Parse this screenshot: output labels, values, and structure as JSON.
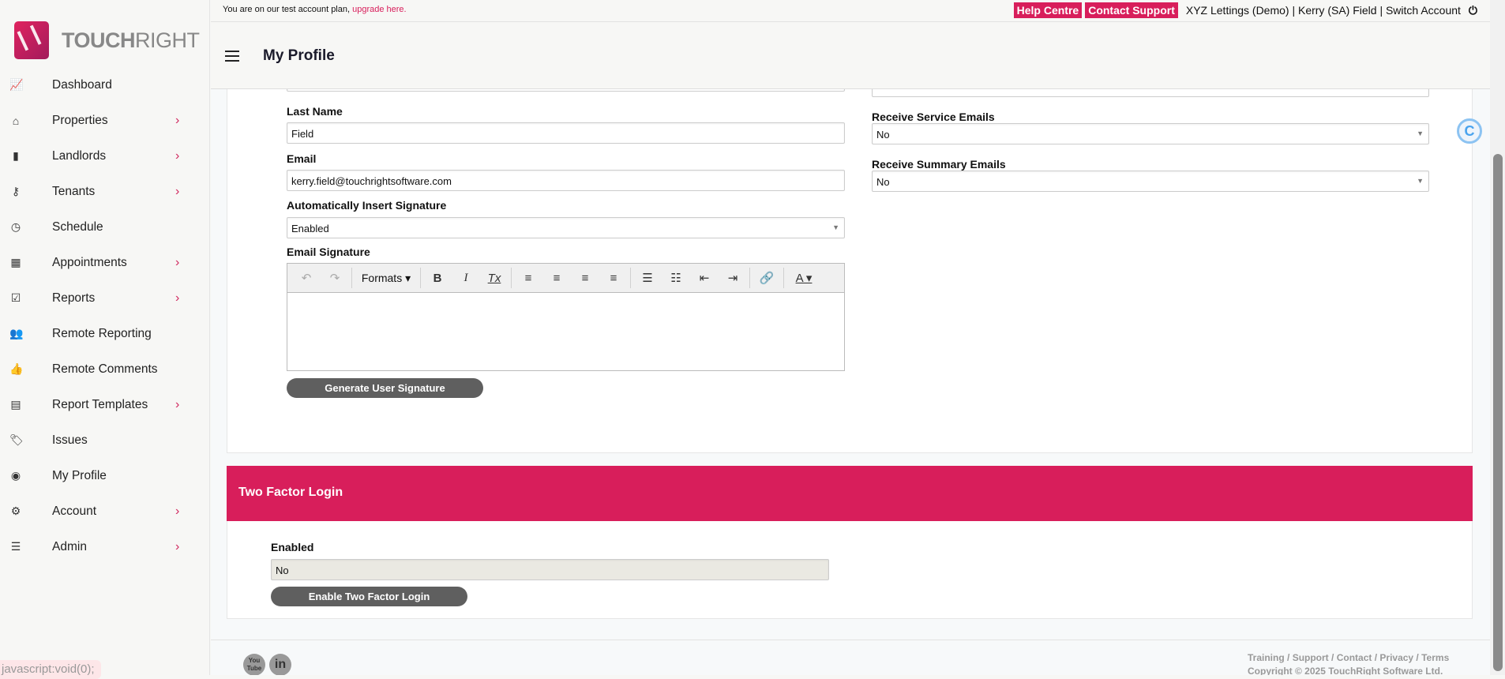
{
  "brand": {
    "logo_text_bold": "TOUCH",
    "logo_text_light": "RIGHT"
  },
  "topbar": {
    "plan_text": "You are on our test account plan, ",
    "upgrade_link": "upgrade here.",
    "help_centre": "Help Centre",
    "contact_support": "Contact Support",
    "account_text": "XYZ Lettings (Demo) | Kerry (SA) Field | Switch Account",
    "power_icon": "⏻"
  },
  "header": {
    "title": "My Profile"
  },
  "sidebar": {
    "items": [
      {
        "label": "Dashboard",
        "icon": "📈",
        "chevron": false
      },
      {
        "label": "Properties",
        "icon": "⌂",
        "chevron": true
      },
      {
        "label": "Landlords",
        "icon": "▮",
        "chevron": true
      },
      {
        "label": "Tenants",
        "icon": "⚷",
        "chevron": true
      },
      {
        "label": "Schedule",
        "icon": "◷",
        "chevron": false
      },
      {
        "label": "Appointments",
        "icon": "▦",
        "chevron": true
      },
      {
        "label": "Reports",
        "icon": "☑",
        "chevron": true
      },
      {
        "label": "Remote Reporting",
        "icon": "👥",
        "chevron": false
      },
      {
        "label": "Remote Comments",
        "icon": "👍",
        "chevron": false
      },
      {
        "label": "Report Templates",
        "icon": "▤",
        "chevron": true
      },
      {
        "label": "Issues",
        "icon": "🏷",
        "chevron": false
      },
      {
        "label": "My Profile",
        "icon": "◉",
        "chevron": false
      },
      {
        "label": "Account",
        "icon": "⚙",
        "chevron": true
      },
      {
        "label": "Admin",
        "icon": "☰",
        "chevron": true
      }
    ],
    "chevron": "›",
    "link_tooltip": "javascript:void(0);"
  },
  "profile": {
    "last_name_label": "Last Name",
    "last_name": "Field",
    "email_label": "Email",
    "email": "kerry.field@touchrightsoftware.com",
    "auto_sig_label": "Automatically Insert Signature",
    "auto_sig": "Enabled",
    "email_sig_label": "Email Signature",
    "toolbar": {
      "undo": "↶",
      "redo": "↷",
      "formats": "Formats ▾",
      "bold": "B",
      "italic": "I",
      "clear": "Tx",
      "align_left": "≡",
      "align_center": "≡",
      "align_right": "≡",
      "justify": "≡",
      "bullets": "☰",
      "numbers": "☷",
      "outdent": "⇤",
      "indent": "⇥",
      "link": "🔗",
      "color": "A ▾"
    },
    "generate_btn": "Generate User Signature",
    "service_label": "Receive Service Emails",
    "service": "No",
    "summary_label": "Receive Summary Emails",
    "summary": "No"
  },
  "two_factor": {
    "title": "Two Factor Login",
    "enabled_label": "Enabled",
    "enabled": "No",
    "button": "Enable Two Factor Login"
  },
  "footer": {
    "links": [
      "Training",
      "Support",
      "Contact",
      "Privacy",
      "Terms"
    ],
    "sep": " / ",
    "copyright": "Copyright © 2025 TouchRight Software Ltd.",
    "youtube": "You Tube",
    "linkedin": "in"
  },
  "widget": {
    "label": "C"
  }
}
